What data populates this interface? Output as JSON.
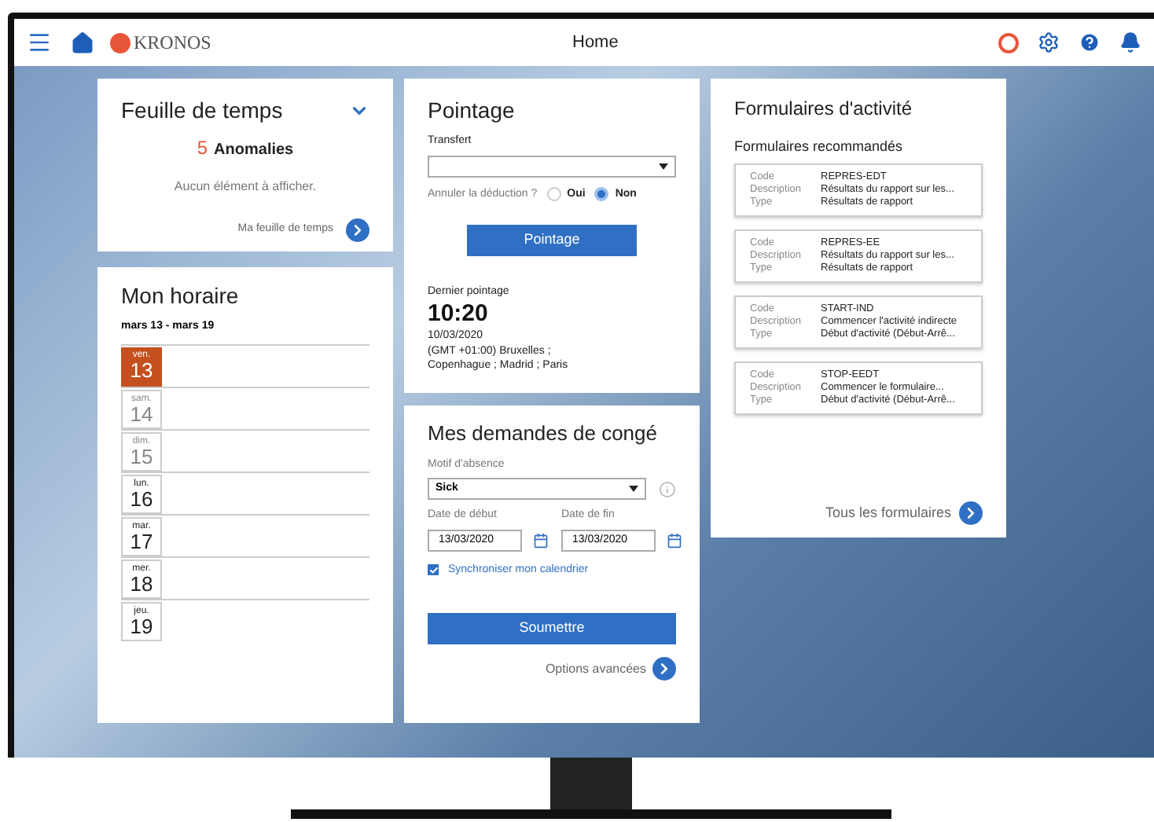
{
  "header": {
    "title": "Home",
    "logo": "KRONOS"
  },
  "timesheet": {
    "title": "Feuille de temps",
    "count": "5",
    "count_label": "Anomalies",
    "empty": "Aucun élément à afficher.",
    "link": "Ma feuille de temps"
  },
  "schedule": {
    "title": "Mon horaire",
    "range": "mars 13 - mars 19",
    "days": [
      {
        "weekday": "ven.",
        "day": "13",
        "selected": true,
        "disabled": false
      },
      {
        "weekday": "sam.",
        "day": "14",
        "selected": false,
        "disabled": true
      },
      {
        "weekday": "dim.",
        "day": "15",
        "selected": false,
        "disabled": true
      },
      {
        "weekday": "lun.",
        "day": "16",
        "selected": false,
        "disabled": false
      },
      {
        "weekday": "mar.",
        "day": "17",
        "selected": false,
        "disabled": false
      },
      {
        "weekday": "mer.",
        "day": "18",
        "selected": false,
        "disabled": false
      },
      {
        "weekday": "jeu.",
        "day": "19",
        "selected": false,
        "disabled": false
      }
    ]
  },
  "punch": {
    "title": "Pointage",
    "transfer_label": "Transfert",
    "cancel_label": "Annuler la déduction ?",
    "options": [
      {
        "label": "Oui",
        "selected": false
      },
      {
        "label": "Non",
        "selected": true
      }
    ],
    "button": "Pointage",
    "last_label": "Dernier pointage",
    "last_time": "10:20",
    "last_date": "10/03/2020",
    "last_zone": "(GMT +01:00) Bruxelles ; Copenhague ; Madrid ; Paris"
  },
  "leave": {
    "title": "Mes demandes de congé",
    "reason_label": "Motif d'absence",
    "reason": "Sick",
    "start_label": "Date de début",
    "start": "13/03/2020",
    "end_label": "Date de fin",
    "end": "13/03/2020",
    "sync_label": "Synchroniser mon calendrier",
    "sync_checked": true,
    "button": "Soumettre",
    "link": "Options avancées"
  },
  "forms": {
    "title": "Formulaires d'activité",
    "subtitle": "Formulaires recommandés",
    "items": [
      {
        "fields": [
          {
            "label": "Code",
            "value": "REPRES-EDT"
          },
          {
            "label": "Description",
            "value": "Résultats du rapport sur les..."
          },
          {
            "label": "Type",
            "value": "Résultats de rapport"
          }
        ]
      },
      {
        "fields": [
          {
            "label": "Code",
            "value": "REPRES-EE"
          },
          {
            "label": "Description",
            "value": "Résultats du rapport sur les..."
          },
          {
            "label": "Type",
            "value": "Résultats de rapport"
          }
        ]
      },
      {
        "fields": [
          {
            "label": "Code",
            "value": "START-IND"
          },
          {
            "label": "Description",
            "value": "Commencer l'activité indirecte"
          },
          {
            "label": "Type",
            "value": "Début d'activité (Début-Arrê..."
          }
        ]
      },
      {
        "fields": [
          {
            "label": "Code",
            "value": "STOP-EEDT"
          },
          {
            "label": "Description",
            "value": "Commencer le formulaire..."
          },
          {
            "label": "Type",
            "value": "Début d'activité (Début-Arrê..."
          }
        ]
      }
    ],
    "link": "Tous les formulaires"
  }
}
